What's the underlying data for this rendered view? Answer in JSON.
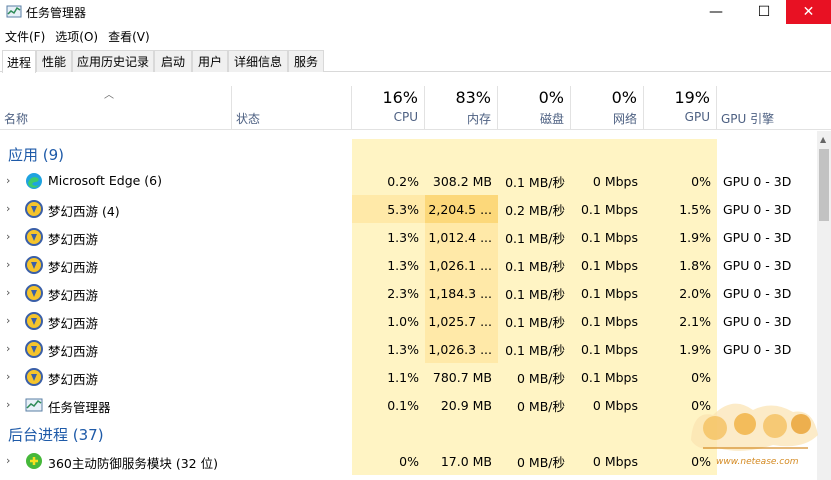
{
  "window": {
    "title": "任务管理器"
  },
  "controls": {
    "minimize": "—",
    "maximize": "☐",
    "close": "✕"
  },
  "menu": [
    "文件(F)",
    "选项(O)",
    "查看(V)"
  ],
  "tabs": [
    "进程",
    "性能",
    "应用历史记录",
    "启动",
    "用户",
    "详细信息",
    "服务"
  ],
  "header": {
    "name": "名称",
    "status": "状态",
    "cpu": {
      "pct": "16%",
      "label": "CPU"
    },
    "memory": {
      "pct": "83%",
      "label": "内存"
    },
    "disk": {
      "pct": "0%",
      "label": "磁盘"
    },
    "network": {
      "pct": "0%",
      "label": "网络"
    },
    "gpu": {
      "pct": "19%",
      "label": "GPU"
    },
    "gpu_engine": "GPU 引擎"
  },
  "groups": {
    "apps": "应用 (9)",
    "background": "后台进程 (37)"
  },
  "processes": [
    {
      "name": "Microsoft Edge (6)",
      "icon": "edge-icon",
      "cpu": "0.2%",
      "mem": "308.2 MB",
      "disk": "0.1 MB/秒",
      "net": "0 Mbps",
      "gpu": "0%",
      "engine": "GPU 0 - 3D"
    },
    {
      "name": "梦幻西游 (4)",
      "icon": "mhxy-icon",
      "cpu": "5.3%",
      "mem": "2,204.5 ...",
      "disk": "0.2 MB/秒",
      "net": "0.1 Mbps",
      "gpu": "1.5%",
      "engine": "GPU 0 - 3D"
    },
    {
      "name": "梦幻西游",
      "icon": "mhxy-icon",
      "cpu": "1.3%",
      "mem": "1,012.4 ...",
      "disk": "0.1 MB/秒",
      "net": "0.1 Mbps",
      "gpu": "1.9%",
      "engine": "GPU 0 - 3D"
    },
    {
      "name": "梦幻西游",
      "icon": "mhxy-icon",
      "cpu": "1.3%",
      "mem": "1,026.1 ...",
      "disk": "0.1 MB/秒",
      "net": "0.1 Mbps",
      "gpu": "1.8%",
      "engine": "GPU 0 - 3D"
    },
    {
      "name": "梦幻西游",
      "icon": "mhxy-icon",
      "cpu": "2.3%",
      "mem": "1,184.3 ...",
      "disk": "0.1 MB/秒",
      "net": "0.1 Mbps",
      "gpu": "2.0%",
      "engine": "GPU 0 - 3D"
    },
    {
      "name": "梦幻西游",
      "icon": "mhxy-icon",
      "cpu": "1.0%",
      "mem": "1,025.7 ...",
      "disk": "0.1 MB/秒",
      "net": "0.1 Mbps",
      "gpu": "2.1%",
      "engine": "GPU 0 - 3D"
    },
    {
      "name": "梦幻西游",
      "icon": "mhxy-icon",
      "cpu": "1.3%",
      "mem": "1,026.3 ...",
      "disk": "0.1 MB/秒",
      "net": "0.1 Mbps",
      "gpu": "1.9%",
      "engine": "GPU 0 - 3D"
    },
    {
      "name": "梦幻西游",
      "icon": "mhxy-icon",
      "cpu": "1.1%",
      "mem": "780.7 MB",
      "disk": "0 MB/秒",
      "net": "0.1 Mbps",
      "gpu": "0%",
      "engine": ""
    },
    {
      "name": "任务管理器",
      "icon": "task-manager-icon",
      "cpu": "0.1%",
      "mem": "20.9 MB",
      "disk": "0 MB/秒",
      "net": "0 Mbps",
      "gpu": "0%",
      "engine": ""
    }
  ],
  "background_processes": [
    {
      "name": "360主动防御服务模块 (32 位)",
      "icon": "360-icon",
      "cpu": "0%",
      "mem": "17.0 MB",
      "disk": "0 MB/秒",
      "net": "0 Mbps",
      "gpu": "0%",
      "engine": ""
    }
  ],
  "watermark": {
    "text": "www.netease.com"
  },
  "colors": {
    "heat_light": "#fff4c4",
    "heat_mid": "#ffe9a8",
    "heat_strong": "#fcd87a",
    "group_title": "#1e5aa8",
    "close_button": "#e81123"
  }
}
